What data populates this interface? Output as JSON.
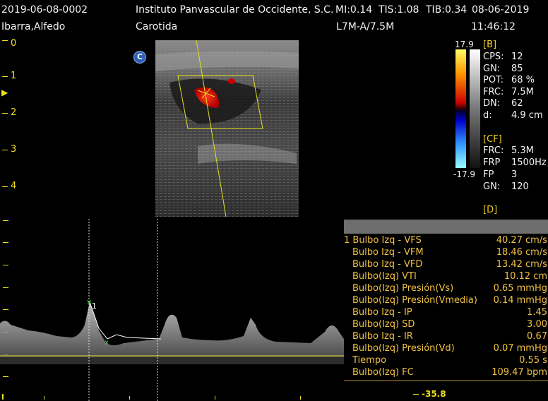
{
  "header": {
    "study_id": "2019-06-08-0002",
    "patient_name": "Ibarra,Alfedo",
    "institution": "Instituto Panvascular de Occidente, S.C.",
    "mi": "MI:0.14",
    "tis": "TIS:1.08",
    "tib": "TIB:0.34",
    "date": "08-06-2019",
    "exam": "Carotida",
    "probe": "L7M-A/7.5M",
    "time": "11:46:12"
  },
  "depth_scale": [
    "0",
    "1",
    "2",
    "3",
    "4"
  ],
  "mode_badge": "C",
  "color_scale": {
    "max": "17.9",
    "min": "-17.9"
  },
  "bmode_params": {
    "section": "[B]",
    "rows": [
      {
        "label": "CPS:",
        "value": "12"
      },
      {
        "label": "GN:",
        "value": "85"
      },
      {
        "label": "POT:",
        "value": "68 %"
      },
      {
        "label": "FRC:",
        "value": "7.5M"
      },
      {
        "label": "DN:",
        "value": "62"
      },
      {
        "label": "d:",
        "value": "4.9 cm"
      }
    ]
  },
  "cf_params": {
    "section": "[CF]",
    "rows": [
      {
        "label": "FRC:",
        "value": "5.3M"
      },
      {
        "label": "FRP",
        "value": "1500Hz"
      },
      {
        "label": "FP",
        "value": "3"
      },
      {
        "label": "GN:",
        "value": "120"
      }
    ]
  },
  "d_params": {
    "section": "[D]"
  },
  "measurements": [
    {
      "label": "1 Bulbo Izq - VFS",
      "value": "40.27 cm/s"
    },
    {
      "label": "Bulbo Izq - VFM",
      "value": "18.46 cm/s"
    },
    {
      "label": "Bulbo Izq - VFD",
      "value": "13.42 cm/s"
    },
    {
      "label": "Bulbo(Izq) VTI",
      "value": "10.12 cm"
    },
    {
      "label": "Bulbo(Izq) Presión(Vs)",
      "value": "0.65 mmHg"
    },
    {
      "label": "Bulbo(Izq) Presión(Vmedia)",
      "value": "0.14 mmHg"
    },
    {
      "label": "Bulbo Izq - IP",
      "value": "1.45"
    },
    {
      "label": "Bulbo(Izq) SD",
      "value": "3.00"
    },
    {
      "label": "Bulbo Izq - IR",
      "value": "0.67"
    },
    {
      "label": "Bulbo(Izq) Presión(Vd)",
      "value": "0.07 mmHg"
    },
    {
      "label": "Tiempo",
      "value": "0.55 s"
    },
    {
      "label": "Bulbo(Izq) FC",
      "value": "109.47 bpm"
    }
  ],
  "doppler": {
    "scale_min_label": "-35.8",
    "cursor_label": "1"
  },
  "colors": {
    "scale_yellow": "#f0e020",
    "measure_orange": "#f0c040",
    "panel_gray": "#6e6e6e"
  }
}
